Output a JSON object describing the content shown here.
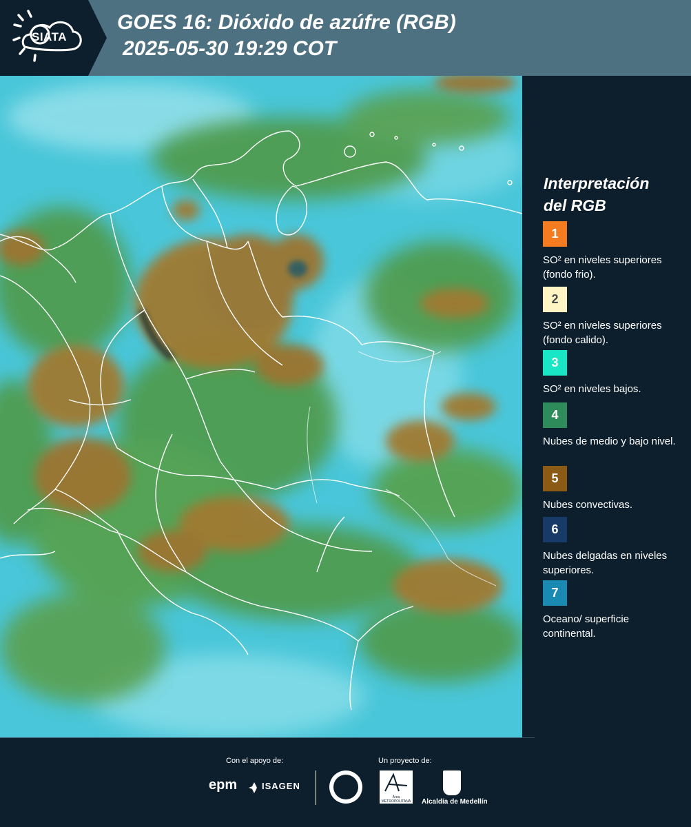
{
  "header": {
    "logo_text": "SIATA",
    "title": "GOES 16: Dióxido de azúfre (RGB)",
    "datetime": "2025-05-30 19:29 COT"
  },
  "legend": {
    "title_line1": "Interpretación",
    "title_line2": "del RGB",
    "items": [
      {
        "number": "1",
        "label": "SO² en niveles superiores (fondo frio).",
        "color": "#f47b20",
        "text_color": "#ffffff"
      },
      {
        "number": "2",
        "label": "SO² en niveles superiores (fondo calido).",
        "color": "#fff5c4",
        "text_color": "#4a4a4a"
      },
      {
        "number": "3",
        "label": "SO² en niveles bajos.",
        "color": "#19e6c4",
        "text_color": "#ffffff"
      },
      {
        "number": "4",
        "label": "Nubes de medio y bajo nivel.",
        "color": "#2e8b5a",
        "text_color": "#ffffff"
      },
      {
        "number": "5",
        "label": "Nubes convectivas.",
        "color": "#8b5a14",
        "text_color": "#ffffff"
      },
      {
        "number": "6",
        "label": "Nubes delgadas en niveles superiores.",
        "color": "#173a66",
        "text_color": "#ffffff"
      },
      {
        "number": "7",
        "label": "Oceano/ superficie continental.",
        "color": "#1a8ab3",
        "text_color": "#ffffff"
      }
    ]
  },
  "footer": {
    "support_label": "Con el apoyo de:",
    "project_label": "Un proyecto de:",
    "sponsors": [
      "epm",
      "ISAGEN"
    ],
    "area_logo_text": "Área METROPOLITANA Valle de Aburrá",
    "partner": "Alcaldía de Medellín"
  },
  "colors": {
    "header_bg": "#4e7182",
    "panel_bg": "#0d1f2d",
    "ocean": "#45c8dc",
    "cloud_mid": "#4f9a4a",
    "cloud_convective": "#a07a30",
    "borders": "#ffffff"
  }
}
